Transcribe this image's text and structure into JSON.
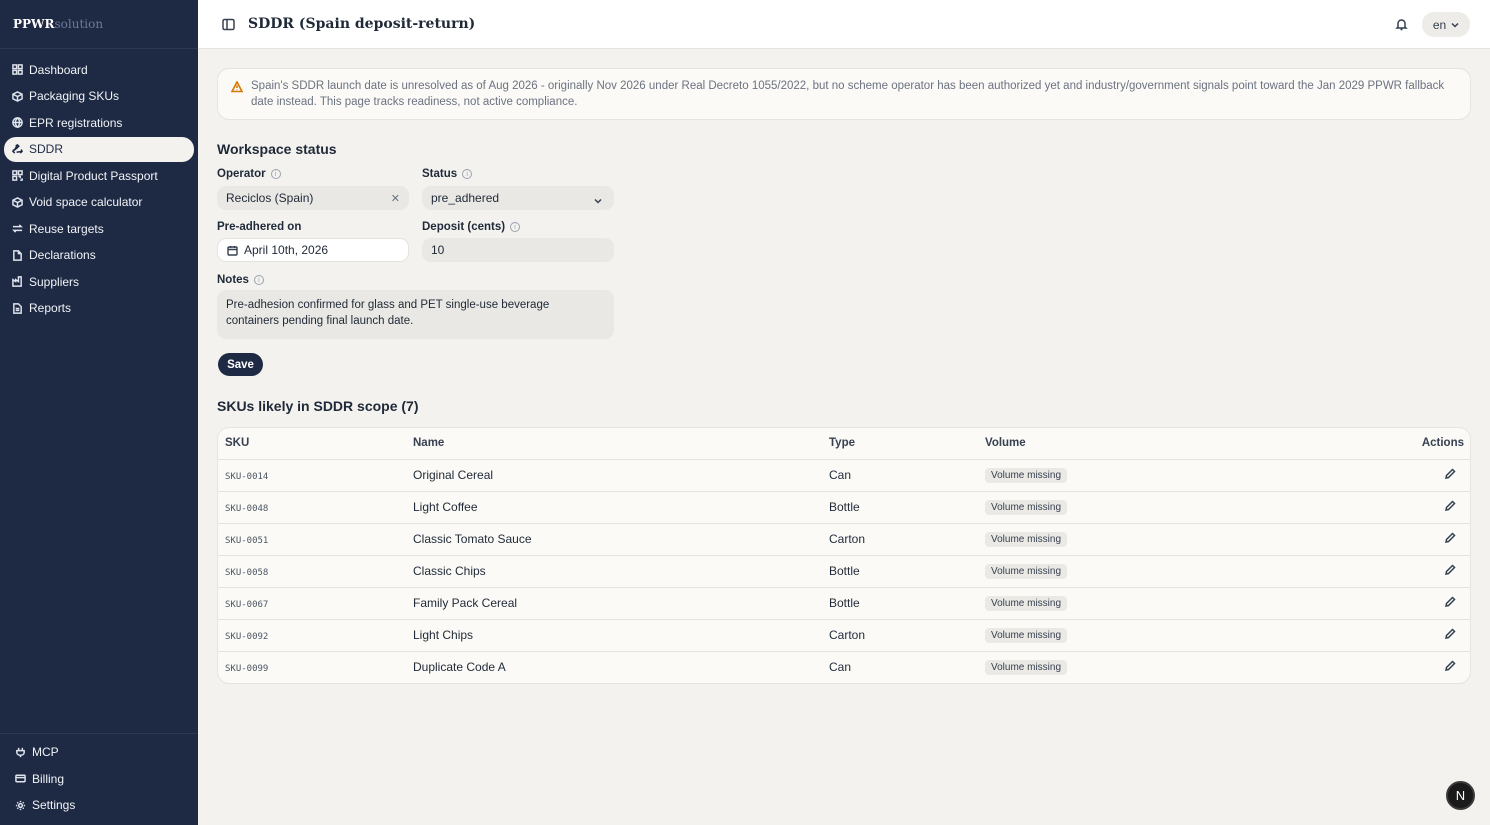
{
  "brand": {
    "part1": "PPWR",
    "part2": "solution"
  },
  "sidebar": {
    "items": [
      {
        "label": "Dashboard",
        "icon": "dashboard-icon"
      },
      {
        "label": "Packaging SKUs",
        "icon": "package-icon"
      },
      {
        "label": "EPR registrations",
        "icon": "globe-icon"
      },
      {
        "label": "SDDR",
        "icon": "recycle-icon"
      },
      {
        "label": "Digital Product Passport",
        "icon": "qr-icon"
      },
      {
        "label": "Void space calculator",
        "icon": "box-icon"
      },
      {
        "label": "Reuse targets",
        "icon": "repeat-icon"
      },
      {
        "label": "Declarations",
        "icon": "file-icon"
      },
      {
        "label": "Suppliers",
        "icon": "factory-icon"
      },
      {
        "label": "Reports",
        "icon": "report-icon"
      }
    ],
    "active": "SDDR",
    "bottom_items": [
      {
        "label": "MCP",
        "icon": "plug-icon"
      },
      {
        "label": "Billing",
        "icon": "card-icon"
      },
      {
        "label": "Settings",
        "icon": "gear-icon"
      }
    ]
  },
  "header": {
    "title": "SDDR (Spain deposit-return)",
    "language": "en"
  },
  "alert": {
    "text": "Spain's SDDR launch date is unresolved as of Aug 2026 - originally Nov 2026 under Real Decreto 1055/2022, but no scheme operator has been authorized yet and industry/government signals point toward the Jan 2029 PPWR fallback date instead. This page tracks readiness, not active compliance."
  },
  "workspace": {
    "title": "Workspace status",
    "operator_label": "Operator",
    "operator_value": "Reciclos (Spain)",
    "status_label": "Status",
    "status_value": "pre_adhered",
    "preadhered_label": "Pre-adhered on",
    "preadhered_value": "April 10th, 2026",
    "deposit_label": "Deposit (cents)",
    "deposit_value": "10",
    "notes_label": "Notes",
    "notes_value": "Pre-adhesion confirmed for glass and PET single-use beverage containers pending final launch date.",
    "save_label": "Save"
  },
  "skus": {
    "title": "SKUs likely in SDDR scope (7)",
    "headers": {
      "sku": "SKU",
      "name": "Name",
      "type": "Type",
      "volume": "Volume",
      "actions": "Actions"
    },
    "rows": [
      {
        "sku": "SKU-0014",
        "name": "Original Cereal",
        "type": "Can",
        "volume": "Volume missing"
      },
      {
        "sku": "SKU-0048",
        "name": "Light Coffee",
        "type": "Bottle",
        "volume": "Volume missing"
      },
      {
        "sku": "SKU-0051",
        "name": "Classic Tomato Sauce",
        "type": "Carton",
        "volume": "Volume missing"
      },
      {
        "sku": "SKU-0058",
        "name": "Classic Chips",
        "type": "Bottle",
        "volume": "Volume missing"
      },
      {
        "sku": "SKU-0067",
        "name": "Family Pack Cereal",
        "type": "Bottle",
        "volume": "Volume missing"
      },
      {
        "sku": "SKU-0092",
        "name": "Light Chips",
        "type": "Carton",
        "volume": "Volume missing"
      },
      {
        "sku": "SKU-0099",
        "name": "Duplicate Code A",
        "type": "Can",
        "volume": "Volume missing"
      }
    ]
  },
  "fab": {
    "label": "N"
  }
}
